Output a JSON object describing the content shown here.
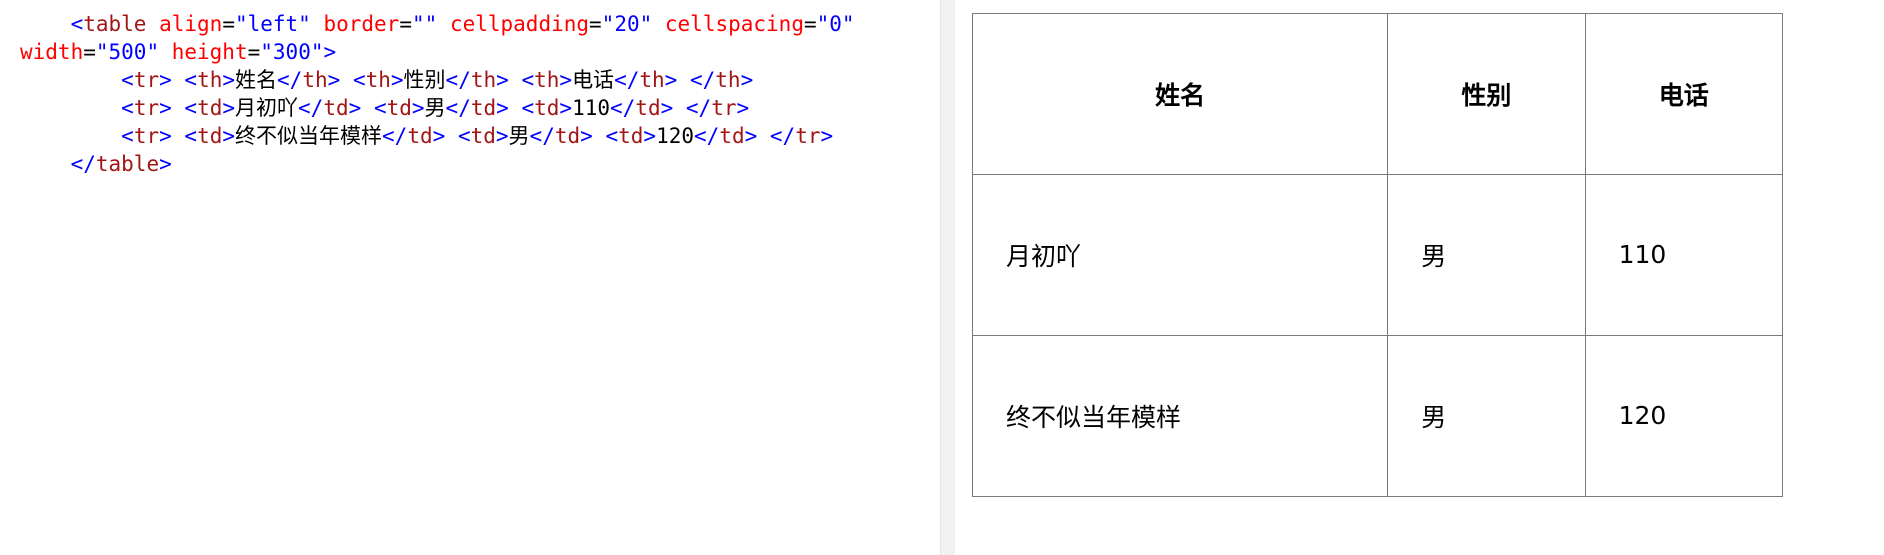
{
  "code_editor": {
    "lines": [
      [
        {
          "t": "    ",
          "c": "punct"
        },
        {
          "t": "<",
          "c": "punct"
        },
        {
          "t": "table",
          "c": "tag"
        },
        {
          "t": " align",
          "c": "attr"
        },
        {
          "t": "=",
          "c": "text"
        },
        {
          "t": "\"left\"",
          "c": "val"
        },
        {
          "t": " border",
          "c": "attr"
        },
        {
          "t": "=",
          "c": "text"
        },
        {
          "t": "\"\"",
          "c": "val"
        },
        {
          "t": " cellpadding",
          "c": "attr"
        },
        {
          "t": "=",
          "c": "text"
        },
        {
          "t": "\"20\"",
          "c": "val"
        },
        {
          "t": " cellspacing",
          "c": "attr"
        },
        {
          "t": "=",
          "c": "text"
        },
        {
          "t": "\"0\"",
          "c": "val"
        }
      ],
      [
        {
          "t": "width",
          "c": "attr"
        },
        {
          "t": "=",
          "c": "text"
        },
        {
          "t": "\"500\"",
          "c": "val"
        },
        {
          "t": " height",
          "c": "attr"
        },
        {
          "t": "=",
          "c": "text"
        },
        {
          "t": "\"300\"",
          "c": "val"
        },
        {
          "t": ">",
          "c": "punct"
        }
      ],
      [
        {
          "t": "        ",
          "c": "text"
        },
        {
          "t": "<",
          "c": "punct"
        },
        {
          "t": "tr",
          "c": "tag"
        },
        {
          "t": ">",
          "c": "punct"
        },
        {
          "t": " ",
          "c": "text"
        },
        {
          "t": "<",
          "c": "punct"
        },
        {
          "t": "th",
          "c": "tag"
        },
        {
          "t": ">",
          "c": "punct"
        },
        {
          "t": "姓名",
          "c": "text"
        },
        {
          "t": "</",
          "c": "punct"
        },
        {
          "t": "th",
          "c": "tag"
        },
        {
          "t": ">",
          "c": "punct"
        },
        {
          "t": " ",
          "c": "text"
        },
        {
          "t": "<",
          "c": "punct"
        },
        {
          "t": "th",
          "c": "tag"
        },
        {
          "t": ">",
          "c": "punct"
        },
        {
          "t": "性别",
          "c": "text"
        },
        {
          "t": "</",
          "c": "punct"
        },
        {
          "t": "th",
          "c": "tag"
        },
        {
          "t": ">",
          "c": "punct"
        },
        {
          "t": " ",
          "c": "text"
        },
        {
          "t": "<",
          "c": "punct"
        },
        {
          "t": "th",
          "c": "tag"
        },
        {
          "t": ">",
          "c": "punct"
        },
        {
          "t": "电话",
          "c": "text"
        },
        {
          "t": "</",
          "c": "punct"
        },
        {
          "t": "th",
          "c": "tag"
        },
        {
          "t": ">",
          "c": "punct"
        },
        {
          "t": " ",
          "c": "text"
        },
        {
          "t": "</",
          "c": "punct"
        },
        {
          "t": "th",
          "c": "tag"
        },
        {
          "t": ">",
          "c": "punct"
        }
      ],
      [
        {
          "t": "        ",
          "c": "text"
        },
        {
          "t": "<",
          "c": "punct"
        },
        {
          "t": "tr",
          "c": "tag"
        },
        {
          "t": ">",
          "c": "punct"
        },
        {
          "t": " ",
          "c": "text"
        },
        {
          "t": "<",
          "c": "punct"
        },
        {
          "t": "td",
          "c": "tag"
        },
        {
          "t": ">",
          "c": "punct"
        },
        {
          "t": "月初吖",
          "c": "text"
        },
        {
          "t": "</",
          "c": "punct"
        },
        {
          "t": "td",
          "c": "tag"
        },
        {
          "t": ">",
          "c": "punct"
        },
        {
          "t": " ",
          "c": "text"
        },
        {
          "t": "<",
          "c": "punct"
        },
        {
          "t": "td",
          "c": "tag"
        },
        {
          "t": ">",
          "c": "punct"
        },
        {
          "t": "男",
          "c": "text"
        },
        {
          "t": "</",
          "c": "punct"
        },
        {
          "t": "td",
          "c": "tag"
        },
        {
          "t": ">",
          "c": "punct"
        },
        {
          "t": " ",
          "c": "text"
        },
        {
          "t": "<",
          "c": "punct"
        },
        {
          "t": "td",
          "c": "tag"
        },
        {
          "t": ">",
          "c": "punct"
        },
        {
          "t": "110",
          "c": "text"
        },
        {
          "t": "</",
          "c": "punct"
        },
        {
          "t": "td",
          "c": "tag"
        },
        {
          "t": ">",
          "c": "punct"
        },
        {
          "t": " ",
          "c": "text"
        },
        {
          "t": "</",
          "c": "punct"
        },
        {
          "t": "tr",
          "c": "tag"
        },
        {
          "t": ">",
          "c": "punct"
        }
      ],
      [
        {
          "t": "        ",
          "c": "text"
        },
        {
          "t": "<",
          "c": "punct"
        },
        {
          "t": "tr",
          "c": "tag"
        },
        {
          "t": ">",
          "c": "punct"
        },
        {
          "t": " ",
          "c": "text"
        },
        {
          "t": "<",
          "c": "punct"
        },
        {
          "t": "td",
          "c": "tag"
        },
        {
          "t": ">",
          "c": "punct"
        },
        {
          "t": "终不似当年模样",
          "c": "text"
        },
        {
          "t": "</",
          "c": "punct"
        },
        {
          "t": "td",
          "c": "tag"
        },
        {
          "t": ">",
          "c": "punct"
        },
        {
          "t": " ",
          "c": "text"
        },
        {
          "t": "<",
          "c": "punct"
        },
        {
          "t": "td",
          "c": "tag"
        },
        {
          "t": ">",
          "c": "punct"
        },
        {
          "t": "男",
          "c": "text"
        },
        {
          "t": "</",
          "c": "punct"
        },
        {
          "t": "td",
          "c": "tag"
        },
        {
          "t": ">",
          "c": "punct"
        },
        {
          "t": " ",
          "c": "text"
        },
        {
          "t": "<",
          "c": "punct"
        },
        {
          "t": "td",
          "c": "tag"
        },
        {
          "t": ">",
          "c": "punct"
        },
        {
          "t": "120",
          "c": "text"
        },
        {
          "t": "</",
          "c": "punct"
        },
        {
          "t": "td",
          "c": "tag"
        },
        {
          "t": ">",
          "c": "punct"
        },
        {
          "t": " ",
          "c": "text"
        },
        {
          "t": "</",
          "c": "punct"
        },
        {
          "t": "tr",
          "c": "tag"
        },
        {
          "t": ">",
          "c": "punct"
        }
      ],
      [
        {
          "t": "    ",
          "c": "text"
        },
        {
          "t": "</",
          "c": "punct"
        },
        {
          "t": "table",
          "c": "tag"
        },
        {
          "t": ">",
          "c": "punct"
        }
      ]
    ]
  },
  "preview_table": {
    "headers": [
      "姓名",
      "性别",
      "电话"
    ],
    "rows": [
      [
        "月初吖",
        "男",
        "110"
      ],
      [
        "终不似当年模样",
        "男",
        "120"
      ]
    ]
  },
  "colors": {
    "tag": "#a31515",
    "attribute": "#ff0000",
    "value": "#0000ff",
    "text": "#000000",
    "border": "#7a7a7a"
  }
}
